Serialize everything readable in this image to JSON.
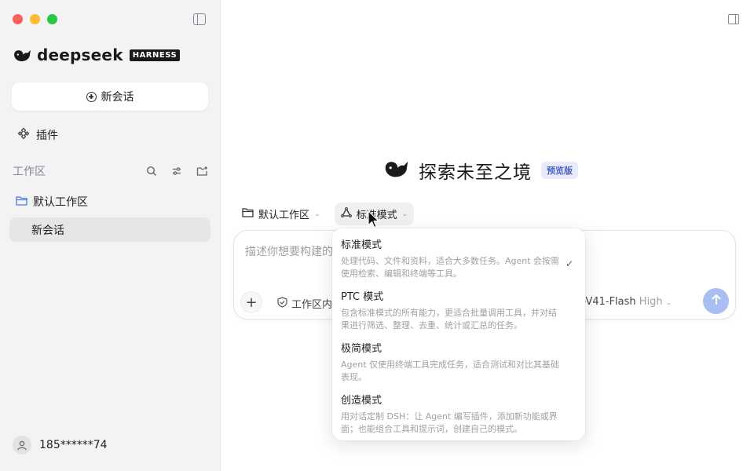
{
  "sidebar": {
    "brand_name": "deepseek",
    "brand_badge": "HARNESS",
    "new_chat_label": "新会话",
    "plugins_label": "插件",
    "workspace_title": "工作区",
    "workspace_name": "默认工作区",
    "session_name": "新会话",
    "user_name": "185******74"
  },
  "main": {
    "hero_title": "探索未至之境",
    "preview_badge": "预览版",
    "workspace_selector": "默认工作区",
    "mode_selector": "标准模式",
    "composer": {
      "placeholder": "描述你想要构建的",
      "scope_label": "工作区内",
      "model_name": "k-V41-Flash",
      "effort": "High"
    }
  },
  "mode_menu": {
    "items": [
      {
        "title": "标准模式",
        "desc": "处理代码、文件和资料，适合大多数任务。Agent 会按需使用检索、编辑和终端等工具。",
        "selected": true
      },
      {
        "title": "PTC 模式",
        "desc": "包含标准模式的所有能力，更适合批量调用工具，并对结果进行筛选、整理、去重、统计或汇总的任务。",
        "selected": false
      },
      {
        "title": "极简模式",
        "desc": "Agent 仅使用终端工具完成任务，适合测试和对比其基础表现。",
        "selected": false
      },
      {
        "title": "创造模式",
        "desc": "用对话定制 DSH：让 Agent 编写插件，添加新功能或界面；也能组合工具和提示词，创建自己的模式。",
        "selected": false
      }
    ]
  },
  "colors": {
    "accent": "#4d63c9",
    "send_button": "#a9bff3",
    "sidebar_bg": "#f3f3f5"
  }
}
